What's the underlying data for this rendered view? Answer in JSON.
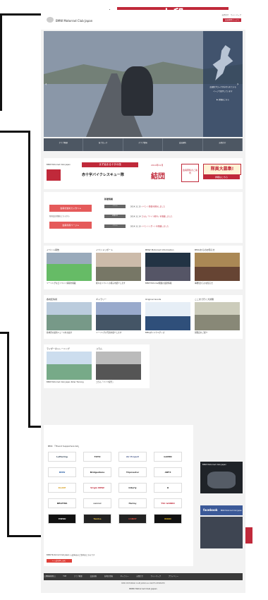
{
  "annotations": {
    "top_label": "上段",
    "middle_label": "中段",
    "bottom_label": "下段"
  },
  "header": {
    "site_name": "BMW Motorrad Club Japan",
    "links": "お問合せ　サイトマップ",
    "member_button": "会員専用ページへ"
  },
  "hero": {
    "panel_text_1": "会員数ブロックが分けられている",
    "panel_text_2": "ページで紹介しています",
    "panel_link": "▶ 詳細はこちら"
  },
  "nav": {
    "items": [
      {
        "label": "クラブ概要"
      },
      {
        "label": "各ブロック"
      },
      {
        "label": "クラブ情報"
      },
      {
        "label": "会員規約"
      },
      {
        "label": "お問合せ"
      }
    ]
  },
  "banner": {
    "logo": "BMW Motorrad Club Japan",
    "event_top": "まず始まる十字の旅",
    "event_main": "赤十字バイクレスキュー隊",
    "date": "2014年11月",
    "kanji": "結団",
    "detail": "会員募集のご案内",
    "recruit": "隊員大募集!",
    "recruit_sub": "詳細はこちら"
  },
  "news": {
    "button_join": "会員を始めたい方へ ▸",
    "join_note": "新規会員登録はこちらから",
    "button_member": "会員専用ページ ▸",
    "heading": "新着情報",
    "rows": [
      {
        "date": "2014.11.15",
        "category": "イベント",
        "text": "イベント情報を更新しました"
      },
      {
        "date": "2014.11.14",
        "category": "お知らせ",
        "text": "コラム「ドイツ紀行」を掲載しました"
      },
      {
        "date": "2014.11.10",
        "category": "イベント",
        "text": "イベントレポートを掲載しました"
      }
    ]
  },
  "cards_row1": [
    {
      "title": "イベント報告",
      "caption": "ツーリングなどイベント情報を掲載"
    },
    {
      "title": "イベントリポート",
      "caption": "様々なイベントの様子を紹介します"
    },
    {
      "title": "BMW Motorrad Information",
      "caption": "BMW Motorrad関連の最新情報"
    },
    {
      "title": "BMCJからのお知らせ",
      "caption": "事務局からのお知らせ"
    }
  ],
  "cards_row2": [
    {
      "title": "各地区情報",
      "caption": "各地区の最新ニュースをお届け"
    },
    {
      "title": "ギャラリー",
      "caption": "ツーリングの写真を紹介します"
    },
    {
      "title": "Original Goods",
      "caption": "BMCJオリジナルグッズ"
    },
    {
      "title": "ここまで行く大冒険",
      "caption": "冒険記のご紹介"
    }
  ],
  "cards_row3": [
    {
      "title": "ライダーのトレーニング",
      "caption": "BMW Motorrad Club Japan Rider Training"
    },
    {
      "title": "コラム",
      "caption": "コラム「ドイツ紀行」"
    }
  ],
  "sponsors": {
    "heading": "BMC 「Friend Supporters list」",
    "logos": [
      "Lettering",
      "TOYO",
      "Air Project",
      "GAMIN",
      "BMW",
      "Bridgestone",
      "Tripmaster",
      "ABFZ",
      "KLAVE",
      "Virgin BMW",
      "Interly",
      "O",
      "DELPHIA",
      "sannol",
      "Harley",
      "YSC GANKO",
      "YAESU",
      "Tamba",
      "CANDY",
      "ROAD"
    ],
    "entry_text": "BMW Motorrad Club Japan 入会申込のご案内はこちらです",
    "entry_button": "▸ 入会を申し込む"
  },
  "sidebar": {
    "video_title": "BMW Motorrad Club Japan",
    "facebook": "facebook",
    "facebook_sub": "BMW Motorrad Club Japan"
  },
  "footer": {
    "links": [
      "ENGLISH",
      "TOP",
      "クラブ概要",
      "会員規約",
      "各地区情報",
      "ギャラリー",
      "お問合せ",
      "サイトマップ",
      "プライバシー"
    ],
    "copyright": "BMW MOTORRAD CLUB JAPAN ALL RIGHTS RESERVED",
    "site_name": "BMW Motorrad Club Japan"
  },
  "colors": {
    "accent": "#c0293a",
    "nav": "#4d5763",
    "facebook": "#3b5998"
  }
}
